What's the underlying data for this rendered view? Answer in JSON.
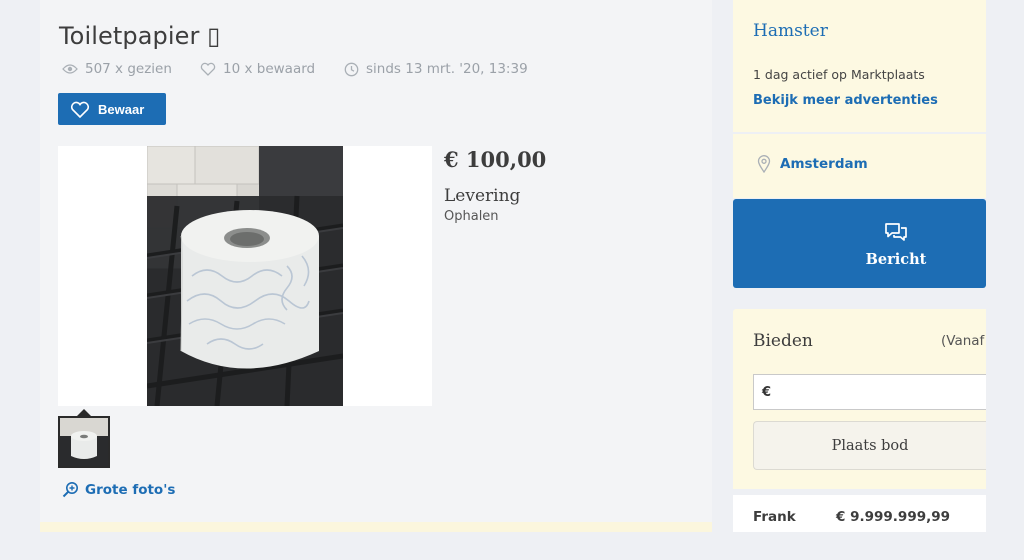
{
  "listing": {
    "title": "Toiletpapier ▯",
    "views": "507 x gezien",
    "saved": "10 x bewaard",
    "since": "sinds 13 mrt. '20, 13:39",
    "save_button": "Bewaar",
    "price": "€ 100,00",
    "delivery_heading": "Levering",
    "delivery_value": "Ophalen",
    "big_photos_link": "Grote foto's"
  },
  "seller": {
    "name": "Hamster",
    "active": "1 dag actief op Marktplaats",
    "more_ads": "Bekijk meer advertenties",
    "location": "Amsterdam"
  },
  "message_button": "Bericht",
  "bidding": {
    "title": "Bieden",
    "from_label": "(Vanaf",
    "currency_prefix": "€",
    "place_bid_button": "Plaats bod",
    "bids": [
      {
        "name": "Frank",
        "amount": "€ 9.999.999,99"
      }
    ]
  },
  "colors": {
    "accent": "#1d6db4",
    "sidebar_bg": "#fdf9e2",
    "page_bg": "#f3f4f6"
  },
  "icons": [
    "eye-icon",
    "heart-icon",
    "clock-icon",
    "location-pin-icon",
    "chat-bubbles-icon",
    "zoom-in-icon"
  ]
}
